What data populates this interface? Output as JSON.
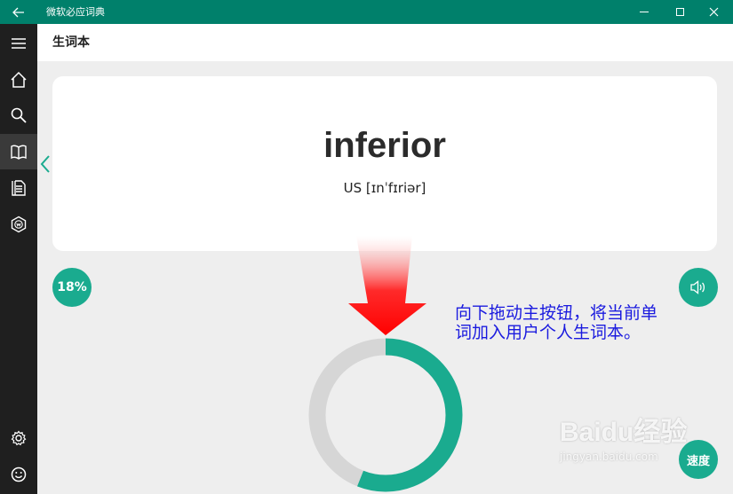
{
  "window": {
    "title": "微软必应词典"
  },
  "header": {
    "title": "生词本"
  },
  "sidebar": {
    "items": [
      {
        "icon": "home-icon"
      },
      {
        "icon": "search-icon"
      },
      {
        "icon": "book-icon",
        "active": true
      },
      {
        "icon": "wordbook-icon"
      },
      {
        "icon": "hexagon-w-icon"
      },
      {
        "icon": "gear-icon"
      },
      {
        "icon": "smiley-icon"
      }
    ]
  },
  "card": {
    "word": "inferior",
    "phonetic": "US [ɪnˈfɪriər]"
  },
  "progress": {
    "label": "18%",
    "ring_fraction": 0.56
  },
  "buttons": {
    "speed_label": "速度"
  },
  "annotation": {
    "text": "向下拖动主按钮，将当前单词加入用户个人生词本。"
  },
  "watermark": {
    "main": "Baidu经验",
    "sub": "jingyan.baidu.com"
  },
  "colors": {
    "titlebar": "#00806b",
    "accent": "#1aab8f",
    "sidebar": "#1f1f1f",
    "annotation": "#1a1adf",
    "arrow": "#ff0000"
  }
}
